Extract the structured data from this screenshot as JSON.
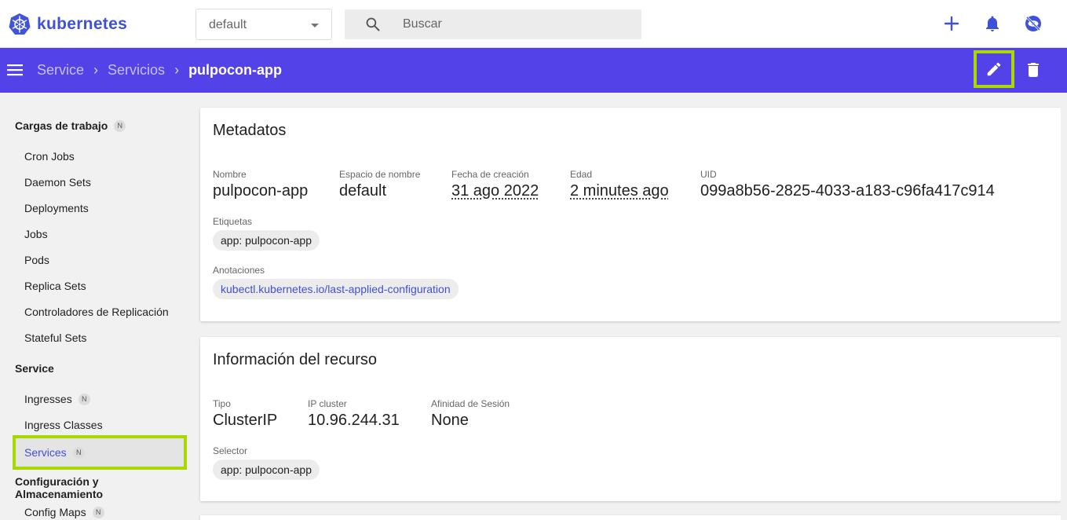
{
  "app": {
    "name": "kubernetes"
  },
  "namespace": {
    "selected": "default"
  },
  "search": {
    "placeholder": "Buscar"
  },
  "topActions": [
    "add-icon",
    "bell-icon",
    "no-eye-icon"
  ],
  "toolbar": {
    "crumbs": [
      "Service",
      "Servicios"
    ],
    "current": "pulpocon-app",
    "actions": [
      "edit-icon",
      "delete-icon"
    ]
  },
  "sidebar": {
    "workloads": {
      "title": "Cargas de trabajo",
      "badge": "N",
      "items": [
        "Cron Jobs",
        "Daemon Sets",
        "Deployments",
        "Jobs",
        "Pods",
        "Replica Sets",
        "Controladores de Replicación",
        "Stateful Sets"
      ]
    },
    "service": {
      "title": "Service",
      "items": [
        {
          "label": "Ingresses",
          "badge": "N"
        },
        {
          "label": "Ingress Classes",
          "badge": ""
        },
        {
          "label": "Services",
          "badge": "N"
        }
      ]
    },
    "config": {
      "title": "Configuración y Almacenamiento",
      "items": [
        {
          "label": "Config Maps",
          "badge": "N"
        }
      ]
    }
  },
  "metadata": {
    "title": "Metadatos",
    "fields": {
      "name": {
        "label": "Nombre",
        "value": "pulpocon-app"
      },
      "namespace": {
        "label": "Espacio de nombre",
        "value": "default"
      },
      "created": {
        "label": "Fecha de creación",
        "value": "31 ago 2022"
      },
      "age": {
        "label": "Edad",
        "value": "2 minutes ago"
      },
      "uid": {
        "label": "UID",
        "value": "099a8b56-2825-4033-a183-c96fa417c914"
      }
    },
    "labels": {
      "label": "Etiquetas",
      "chip": "app: pulpocon-app"
    },
    "annotations": {
      "label": "Anotaciones",
      "chip": "kubectl.kubernetes.io/last-applied-configuration"
    }
  },
  "resource": {
    "title": "Información del recurso",
    "fields": {
      "type": {
        "label": "Tipo",
        "value": "ClusterIP"
      },
      "ip": {
        "label": "IP cluster",
        "value": "10.96.244.31"
      },
      "affinity": {
        "label": "Afinidad de Sesión",
        "value": "None"
      }
    },
    "selector": {
      "label": "Selector",
      "chip": "app: pulpocon-app"
    }
  },
  "colors": {
    "brand": "#3f51d6",
    "toolbar": "#5242e8",
    "highlight": "#a8d800"
  }
}
